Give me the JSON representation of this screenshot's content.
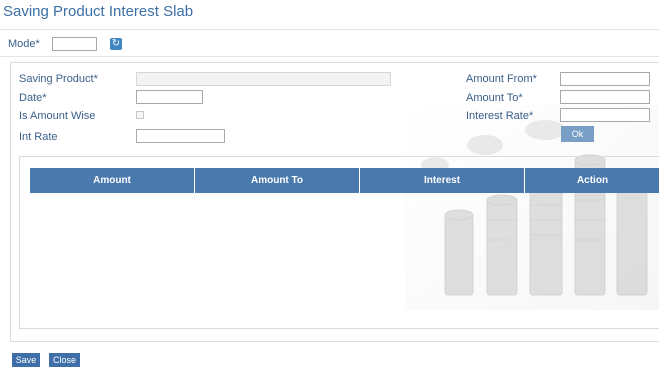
{
  "header": {
    "title": "Saving Product Interest Slab"
  },
  "mode": {
    "label": "Mode*",
    "value": "",
    "refresh_icon": "refresh-icon"
  },
  "form": {
    "saving_product": {
      "label": "Saving Product*",
      "value": ""
    },
    "date": {
      "label": "Date*",
      "value": ""
    },
    "is_amount_wise": {
      "label": "Is Amount Wise",
      "checked": false
    },
    "int_rate": {
      "label": "Int Rate",
      "value": ""
    },
    "amount_from": {
      "label": "Amount From*",
      "value": ""
    },
    "amount_to": {
      "label": "Amount To*",
      "value": ""
    },
    "interest_rate": {
      "label": "Interest Rate*",
      "value": ""
    },
    "ok_label": "Ok"
  },
  "table": {
    "columns": [
      "Amount",
      "Amount To",
      "Interest",
      "Action"
    ],
    "rows": []
  },
  "footer": {
    "save_label": "Save",
    "close_label": "Close"
  },
  "colors": {
    "accent": "#4a79ae",
    "label": "#3a5f8a",
    "button": "#3f6fa8",
    "ok_button": "#7a9fc6"
  }
}
